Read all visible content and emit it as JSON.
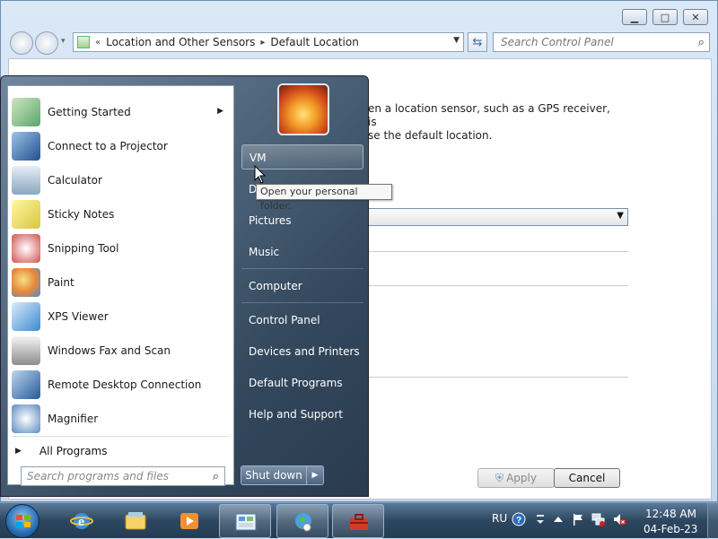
{
  "window": {
    "breadcrumb": [
      "Location and Other Sensors",
      "Default Location"
    ],
    "search_placeholder": "Search Control Panel",
    "description_line1": "en a location sensor, such as a GPS receiver, is",
    "description_line2": "se the default location.",
    "apply_label": "Apply",
    "cancel_label": "Cancel"
  },
  "start_menu": {
    "programs": [
      {
        "label": "Getting Started",
        "icon": "getting-started-icon",
        "has_submenu": true
      },
      {
        "label": "Connect to a Projector",
        "icon": "projector-icon"
      },
      {
        "label": "Calculator",
        "icon": "calculator-icon"
      },
      {
        "label": "Sticky Notes",
        "icon": "sticky-notes-icon"
      },
      {
        "label": "Snipping Tool",
        "icon": "scissors-icon"
      },
      {
        "label": "Paint",
        "icon": "paint-icon"
      },
      {
        "label": "XPS Viewer",
        "icon": "xps-viewer-icon"
      },
      {
        "label": "Windows Fax and Scan",
        "icon": "fax-icon"
      },
      {
        "label": "Remote Desktop Connection",
        "icon": "remote-desktop-icon"
      },
      {
        "label": "Magnifier",
        "icon": "magnifier-icon"
      }
    ],
    "all_programs_label": "All Programs",
    "search_placeholder": "Search programs and files",
    "right_items": {
      "user": "VM",
      "documents": "D",
      "pictures": "Pictures",
      "music": "Music",
      "computer": "Computer",
      "control_panel": "Control Panel",
      "devices_printers": "Devices and Printers",
      "default_programs": "Default Programs",
      "help_support": "Help and Support"
    },
    "shutdown_label": "Shut down",
    "tooltip": "Open your personal folder."
  },
  "taskbar": {
    "language": "RU",
    "time": "12:48 AM",
    "date": "04-Feb-23"
  }
}
